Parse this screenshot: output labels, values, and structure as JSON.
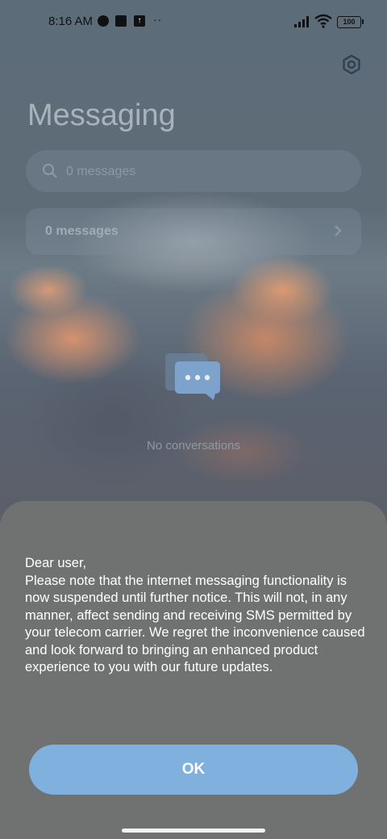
{
  "status_bar": {
    "time": "8:16 AM",
    "battery": "100",
    "more_indicator": "··"
  },
  "header": {
    "title": "Messaging"
  },
  "search": {
    "placeholder": "0 messages"
  },
  "summary_row": {
    "label": "0 messages"
  },
  "empty_state": {
    "text": "No conversations"
  },
  "dialog": {
    "message": "Dear user,\nPlease note that the internet messaging functionality is now suspended until further notice. This will not, in any manner, affect sending and receiving SMS permitted by your telecom carrier. We regret the inconvenience caused and look forward to bringing an enhanced product experience to you with our future updates.",
    "ok_label": "OK"
  },
  "colors": {
    "button": "#7fb0de",
    "sheet": "#707272",
    "text_on_sheet": "#ffffff"
  },
  "icons": [
    "settings-icon",
    "search-icon",
    "chevron-right-icon",
    "chat-bubbles-icon",
    "wifi-icon",
    "signal-icon",
    "battery-icon"
  ]
}
